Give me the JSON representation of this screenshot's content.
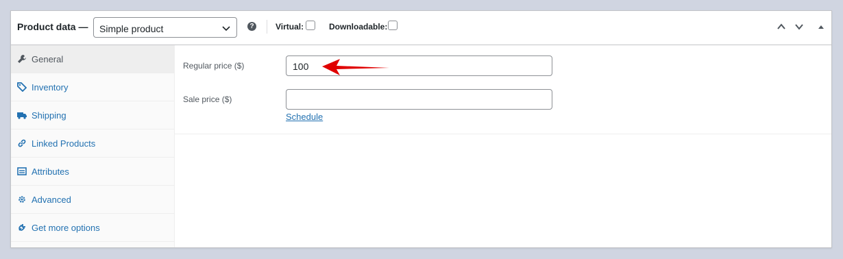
{
  "header": {
    "title": "Product data —",
    "product_type": "Simple product",
    "help": "?",
    "virtual_label": "Virtual:",
    "downloadable_label": "Downloadable:",
    "icons": [
      "chevron-up-icon",
      "chevron-down-icon",
      "collapse-triangle-icon"
    ]
  },
  "sidebar": {
    "items": [
      {
        "label": "General",
        "icon": "wrench-icon",
        "active": true
      },
      {
        "label": "Inventory",
        "icon": "tag-icon"
      },
      {
        "label": "Shipping",
        "icon": "truck-icon"
      },
      {
        "label": "Linked Products",
        "icon": "link-icon"
      },
      {
        "label": "Attributes",
        "icon": "list-icon"
      },
      {
        "label": "Advanced",
        "icon": "gear-icon"
      },
      {
        "label": "Get more options",
        "icon": "plugin-icon"
      }
    ]
  },
  "general": {
    "regular_price_label": "Regular price ($)",
    "regular_price_value": "100",
    "sale_price_label": "Sale price ($)",
    "sale_price_value": "",
    "schedule_link": "Schedule"
  },
  "colors": {
    "link": "#2271b1",
    "annotation_arrow": "#e00000"
  }
}
